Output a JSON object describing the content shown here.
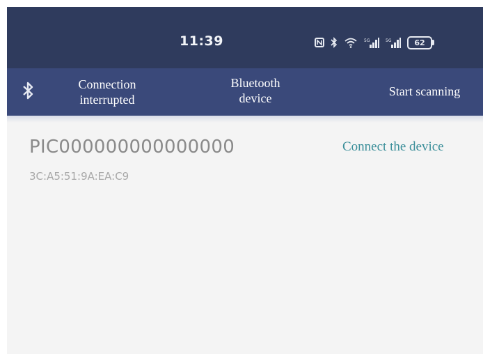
{
  "status_bar": {
    "time": "11:39",
    "battery_level": "62",
    "icons": [
      "nfc-icon",
      "bluetooth-icon",
      "wifi-icon",
      "signal-icon",
      "signal-icon",
      "battery-icon"
    ]
  },
  "toolbar": {
    "status_line1": "Connection",
    "status_line2": "interrupted",
    "device_line1": "Bluetooth",
    "device_line2": "device",
    "scan_label": "Start scanning"
  },
  "devices": [
    {
      "name": "PIC000000000000000",
      "mac": "3C:A5:51:9A:EA:C9",
      "action": "Connect the device"
    }
  ],
  "colors": {
    "status_bar_bg": "#2f3b5d",
    "toolbar_bg": "#3a497a",
    "content_bg": "#f4f4f4",
    "link": "#3a8e99"
  }
}
